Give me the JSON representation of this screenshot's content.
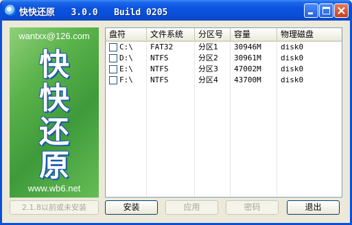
{
  "window": {
    "title": "快快还原   3.0.0   Build 0205",
    "buttons": {
      "minimize": "minimize",
      "maximize": "maximize",
      "close": "close"
    }
  },
  "banner": {
    "email": "wantxx@126.com",
    "logo": "快快还原",
    "site": "www.wb6.net"
  },
  "table": {
    "columns": [
      "盘符",
      "文件系统",
      "分区号",
      "容量",
      "物理磁盘"
    ],
    "rows": [
      {
        "drive": "C:\\",
        "fs": "FAT32",
        "partition": "分区1",
        "capacity": "30946M",
        "disk": "disk0"
      },
      {
        "drive": "D:\\",
        "fs": "NTFS",
        "partition": "分区2",
        "capacity": "30961M",
        "disk": "disk0"
      },
      {
        "drive": "E:\\",
        "fs": "NTFS",
        "partition": "分区3",
        "capacity": "47002M",
        "disk": "disk0"
      },
      {
        "drive": "F:\\",
        "fs": "NTFS",
        "partition": "分区4",
        "capacity": "43700M",
        "disk": "disk0"
      }
    ]
  },
  "footer": {
    "version_note": "2.1.8以前或未安装",
    "install": "安装",
    "apply": "应用",
    "password": "密码",
    "exit": "退出"
  },
  "colors": {
    "titlebar": "#0a4fd8",
    "banner": "#5ab24a",
    "face": "#ece9d8"
  }
}
